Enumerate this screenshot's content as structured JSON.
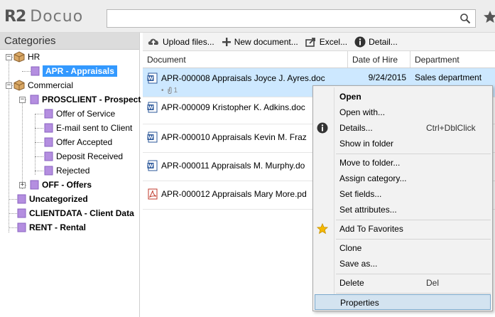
{
  "app": {
    "logo_mark": "R2",
    "logo_name": "Docuo"
  },
  "search": {
    "placeholder": "",
    "value": ""
  },
  "left": {
    "title": "Categories",
    "tree": [
      {
        "label": "HR",
        "icon": "crate-icon",
        "level": 0
      },
      {
        "label": "APR -  Appraisals",
        "icon": "tag-icon",
        "level": 1,
        "selected": true
      },
      {
        "label": "Commercial",
        "icon": "crate-icon",
        "level": 0
      },
      {
        "label": "PROSCLIENT - Prospect",
        "icon": "tag-icon",
        "level": 1,
        "bold": true
      },
      {
        "label": "Offer of Service",
        "icon": "tag-icon",
        "level": 2
      },
      {
        "label": "E-mail sent to Client",
        "icon": "tag-icon",
        "level": 2
      },
      {
        "label": "Offer Accepted",
        "icon": "tag-icon",
        "level": 2
      },
      {
        "label": "Deposit Received",
        "icon": "tag-icon",
        "level": 2
      },
      {
        "label": "Rejected",
        "icon": "tag-icon",
        "level": 2
      },
      {
        "label": "OFF - Offers",
        "icon": "tag-icon",
        "level": 1,
        "bold": true
      },
      {
        "label": "Uncategorized",
        "icon": "tag-icon",
        "level": 0,
        "bold": true
      },
      {
        "label": "CLIENTDATA - Client Data",
        "icon": "tag-icon",
        "level": 0,
        "bold": true
      },
      {
        "label": "RENT - Rental",
        "icon": "tag-icon",
        "level": 0,
        "bold": true
      }
    ]
  },
  "toolbar": {
    "upload": "Upload files...",
    "new_doc": "New document...",
    "excel": "Excel...",
    "detail": "Detail..."
  },
  "table": {
    "columns": [
      "Document",
      "Date of Hire",
      "Department"
    ],
    "rows": [
      {
        "name": "APR-000008 Appraisals Joyce J. Ayres.doc",
        "date": "9/24/2015",
        "dept": "Sales department",
        "attachments": "1",
        "type": "word"
      },
      {
        "name": "APR-000009 Kristopher K. Adkins.doc",
        "date": "",
        "dept": "",
        "type": "word"
      },
      {
        "name": "APR-000010 Appraisals Kevin M. Fraz",
        "date": "",
        "dept": "",
        "type": "word"
      },
      {
        "name": "APR-000011 Appraisals M. Murphy.do",
        "date": "",
        "dept": "",
        "type": "word"
      },
      {
        "name": "APR-000012 Appraisals Mary More.pd",
        "date": "",
        "dept": "",
        "type": "pdf"
      }
    ]
  },
  "menu": {
    "open": "Open",
    "open_with": "Open with...",
    "details": "Details...",
    "details_key": "Ctrl+DblClick",
    "show_in_folder": "Show in folder",
    "move_to_folder": "Move to folder...",
    "assign_category": "Assign category...",
    "set_fields": "Set fields...",
    "set_attributes": "Set attributes...",
    "add_favorites": "Add To Favorites",
    "clone": "Clone",
    "save_as": "Save as...",
    "delete": "Delete",
    "delete_key": "Del",
    "properties": "Properties"
  },
  "colors": {
    "selection": "#3399ff",
    "row_selected": "#cde8ff",
    "tag": "#b48ee0",
    "accent_star": "#f5b800"
  }
}
